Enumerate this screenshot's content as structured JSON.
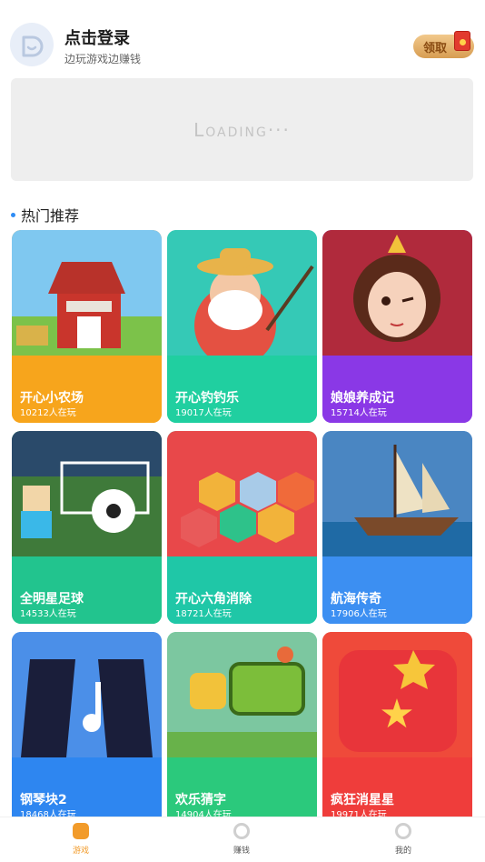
{
  "header": {
    "title": "点击登录",
    "subtitle": "边玩游戏边赚钱",
    "claim_label": "领取",
    "avatar_icon": "smile-face-icon"
  },
  "banner": {
    "loading_text": "Loading···"
  },
  "section": {
    "title": "热门推荐"
  },
  "games": [
    {
      "name": "开心小农场",
      "players": "10212人在玩",
      "color": "#f7a51c",
      "art": "barn"
    },
    {
      "name": "开心钓钓乐",
      "players": "19017人在玩",
      "color": "#20cfa0",
      "art": "fisherman"
    },
    {
      "name": "娘娘养成记",
      "players": "15714人在玩",
      "color": "#8a38e6",
      "art": "empress"
    },
    {
      "name": "全明星足球",
      "players": "14533人在玩",
      "color": "#22c48e",
      "art": "soccer"
    },
    {
      "name": "开心六角消除",
      "players": "18721人在玩",
      "color": "#1fc7a7",
      "art": "hex"
    },
    {
      "name": "航海传奇",
      "players": "17906人在玩",
      "color": "#3c8ff2",
      "art": "ship"
    },
    {
      "name": "钢琴块2",
      "players": "18468人在玩",
      "color": "#2e86f0",
      "art": "piano"
    },
    {
      "name": "欢乐猜字",
      "players": "14904人在玩",
      "color": "#2bc97c",
      "art": "guess"
    },
    {
      "name": "疯狂消星星",
      "players": "19971人在玩",
      "color": "#ef3d3b",
      "art": "star"
    }
  ],
  "tabs": [
    {
      "label": "游戏",
      "icon": "gamepad-icon",
      "active": true
    },
    {
      "label": "赚钱",
      "icon": "coin-icon",
      "active": false
    },
    {
      "label": "我的",
      "icon": "profile-icon",
      "active": false
    }
  ],
  "colors": {
    "accent": "#f29b2a",
    "section_dot": "#2f8cf5"
  }
}
